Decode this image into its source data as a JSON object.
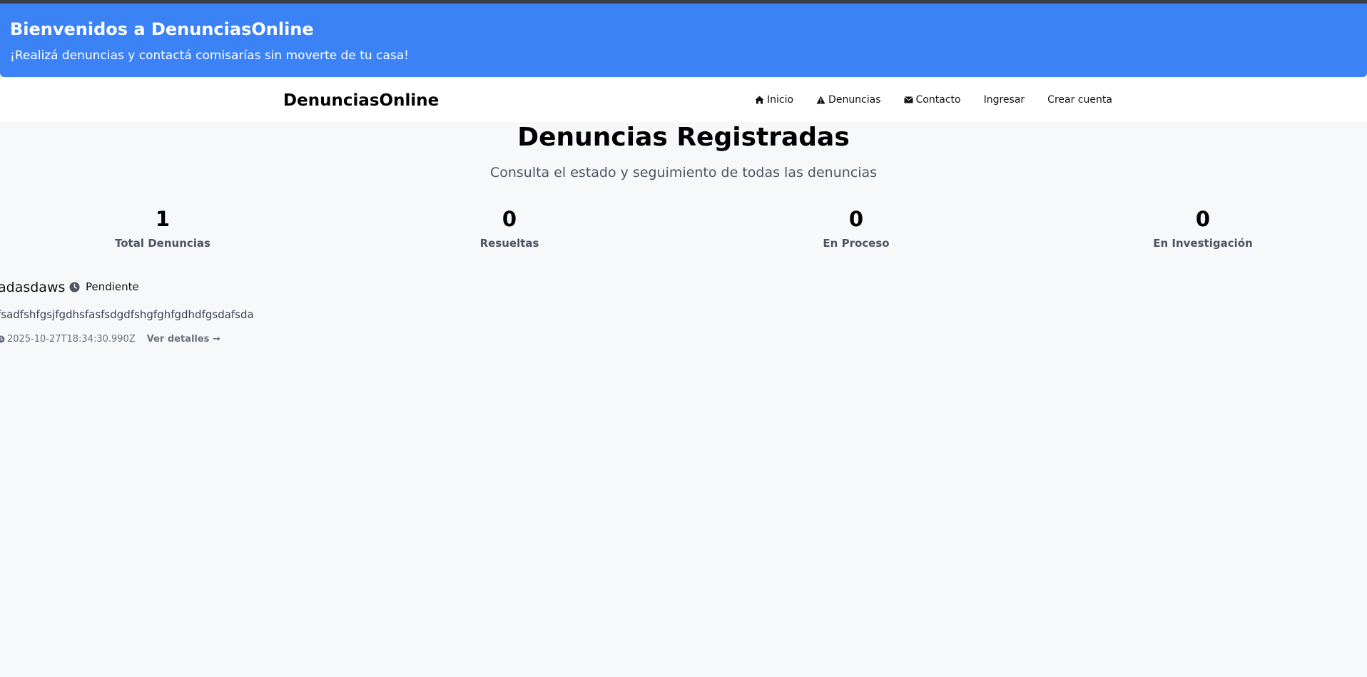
{
  "banner": {
    "title": "Bienvenidos a DenunciasOnline",
    "subtitle": "¡Realizá denuncias y contactá comisarías sin moverte de tu casa!",
    "background_color": "#3b82f6"
  },
  "navbar": {
    "brand": "DenunciasOnline",
    "links": [
      {
        "label": "Inicio",
        "icon": "home-icon"
      },
      {
        "label": "Denuncias",
        "icon": "warning-icon"
      },
      {
        "label": "Contacto",
        "icon": "envelope-icon"
      },
      {
        "label": "Ingresar",
        "icon": ""
      },
      {
        "label": "Crear cuenta",
        "icon": ""
      }
    ]
  },
  "page": {
    "title": "Denuncias Registradas",
    "subtitle": "Consulta el estado y seguimiento de todas las denuncias"
  },
  "stats": [
    {
      "value": "1",
      "label": "Total Denuncias"
    },
    {
      "value": "0",
      "label": "Resueltas"
    },
    {
      "value": "0",
      "label": "En Proceso"
    },
    {
      "value": "0",
      "label": "En Investigación"
    }
  ],
  "denuncias": [
    {
      "title": "adasdaws",
      "status": "Pendiente",
      "status_icon": "clock-icon",
      "description": "fsadfshfgsjfgdhsfasfsdgdfshgfghfgdhdfgsdafsda",
      "timestamp": "2025-10-27T18:34:30.990Z",
      "details_link": "Ver detalles →"
    }
  ]
}
